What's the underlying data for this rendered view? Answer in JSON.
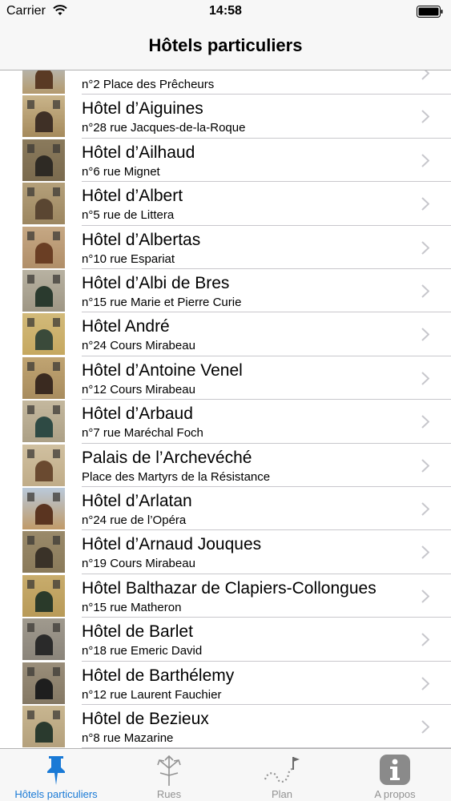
{
  "status": {
    "carrier": "Carrier",
    "time": "14:58"
  },
  "nav": {
    "title": "Hôtels particuliers"
  },
  "list": {
    "items": [
      {
        "title": "",
        "subtitle": "n°2 Place des Prêcheurs",
        "colors": [
          "#b8c6d3",
          "#b49a6e",
          "#5a3a24"
        ]
      },
      {
        "title": "Hôtel d’Aiguines",
        "subtitle": "n°28 rue Jacques-de-la-Roque",
        "colors": [
          "#c9b48a",
          "#a58a5c",
          "#3f3026"
        ]
      },
      {
        "title": "Hôtel d’Ailhaud",
        "subtitle": "n°6 rue Mignet",
        "colors": [
          "#8a7a5c",
          "#7a6a4e",
          "#2e2a24"
        ]
      },
      {
        "title": "Hôtel d’Albert",
        "subtitle": "n°5 rue de Littera",
        "colors": [
          "#b4a07a",
          "#9c8660",
          "#5a4632"
        ]
      },
      {
        "title": "Hôtel d’Albertas",
        "subtitle": "n°10 rue Espariat",
        "colors": [
          "#c6a884",
          "#b08e68",
          "#6a3e24"
        ]
      },
      {
        "title": "Hôtel d’Albi de Bres",
        "subtitle": "n°15 rue Marie et Pierre Curie",
        "colors": [
          "#b8b2a2",
          "#9e9684",
          "#2a3a2e"
        ]
      },
      {
        "title": "Hôtel André",
        "subtitle": "n°24 Cours Mirabeau",
        "colors": [
          "#d2ba7a",
          "#c6a860",
          "#3a4a3a"
        ]
      },
      {
        "title": "Hôtel d’Antoine Venel",
        "subtitle": "n°12 Cours Mirabeau",
        "colors": [
          "#c0a472",
          "#a88c5e",
          "#3a2a20"
        ]
      },
      {
        "title": "Hôtel d’Arbaud",
        "subtitle": "n°7 rue Maréchal Foch",
        "colors": [
          "#c4b89e",
          "#aca086",
          "#2e4a44"
        ]
      },
      {
        "title": "Palais de l’Archevéché",
        "subtitle": "Place des Martyrs de la Résistance",
        "colors": [
          "#d0c0a0",
          "#c0ac88",
          "#6a4a30"
        ]
      },
      {
        "title": "Hôtel d’Arlatan",
        "subtitle": "n°24 rue de l’Opéra",
        "colors": [
          "#b9c9da",
          "#c09a68",
          "#5a3420"
        ]
      },
      {
        "title": "Hôtel d’Arnaud Jouques",
        "subtitle": "n°19 Cours Mirabeau",
        "colors": [
          "#9a8a6a",
          "#8a7a5a",
          "#3a3228"
        ]
      },
      {
        "title": "Hôtel Balthazar de Clapiers-Collongues",
        "subtitle": "n°15 rue Matheron",
        "colors": [
          "#c8ac6c",
          "#b89a58",
          "#2a3a2a"
        ]
      },
      {
        "title": "Hôtel de Barlet",
        "subtitle": "n°18 rue Emeric David",
        "colors": [
          "#a09a8e",
          "#8a847a",
          "#2a2a2a"
        ]
      },
      {
        "title": "Hôtel de Barthélemy",
        "subtitle": "n°12 rue Laurent Fauchier",
        "colors": [
          "#9a8e7a",
          "#847864",
          "#1e1e1e"
        ]
      },
      {
        "title": "Hôtel de Bezieux",
        "subtitle": "n°8 rue Mazarine",
        "colors": [
          "#c8b690",
          "#b4a07c",
          "#2a3a2e"
        ]
      },
      {
        "title": "",
        "subtitle": "",
        "colors": [
          "#d6c4a0",
          "#c4b08a",
          "#5a4a3a"
        ]
      }
    ]
  },
  "tabs": [
    {
      "label": "Hôtels particuliers",
      "icon": "pin-icon",
      "active": true
    },
    {
      "label": "Rues",
      "icon": "signpost-icon",
      "active": false
    },
    {
      "label": "Plan",
      "icon": "route-flag-icon",
      "active": false
    },
    {
      "label": "A propos",
      "icon": "info-icon",
      "active": false
    }
  ],
  "colors": {
    "accent": "#1a7ad6",
    "tab_inactive": "#929292",
    "separator": "#c8c7cc"
  }
}
